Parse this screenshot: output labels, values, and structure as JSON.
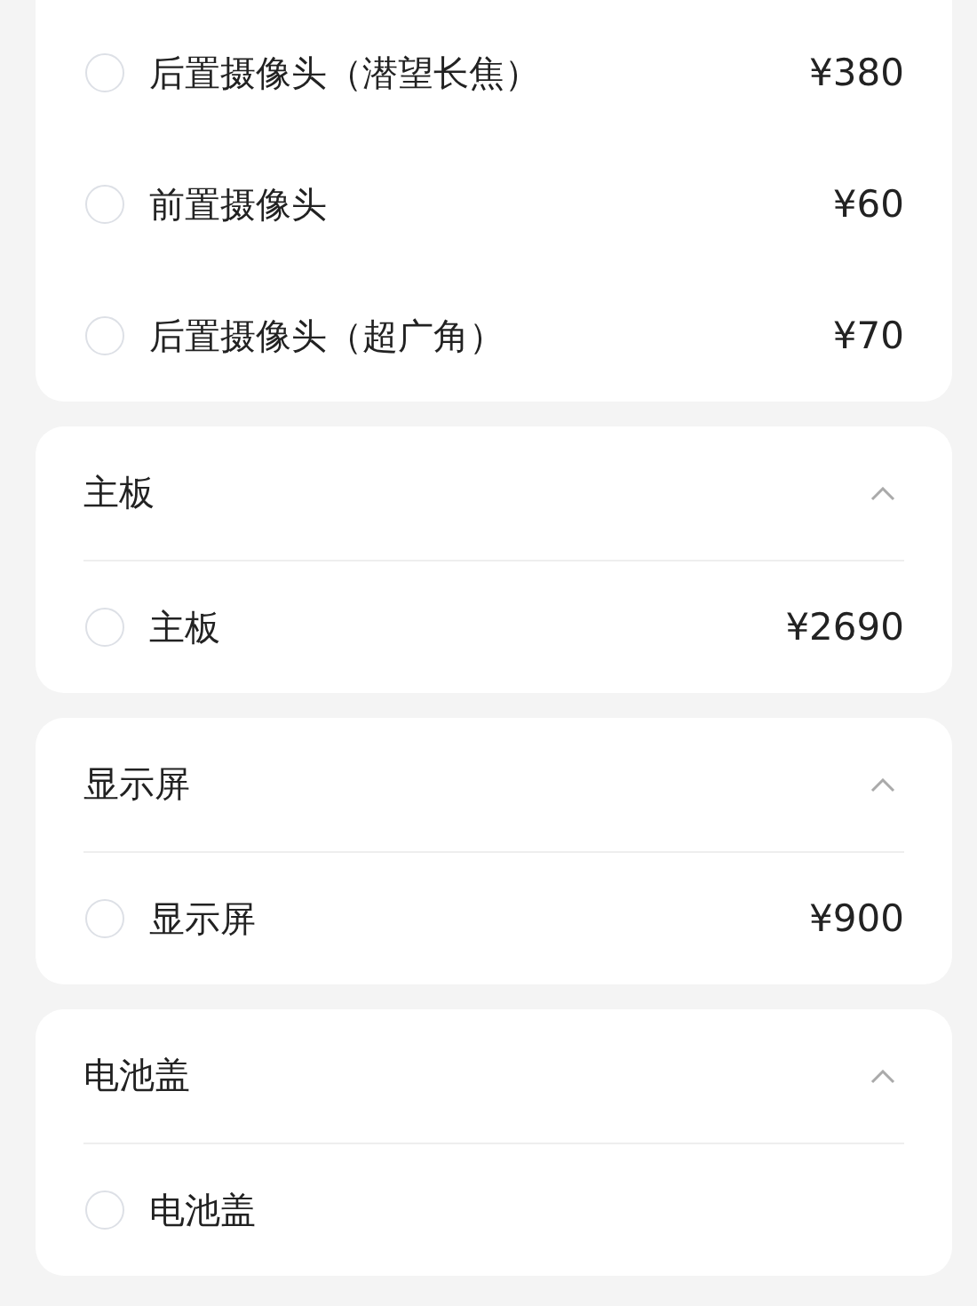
{
  "groups": [
    {
      "items": [
        {
          "name": "后置摄像头（潜望长焦）",
          "price": "¥380",
          "selected": false
        },
        {
          "name": "前置摄像头",
          "price": "¥60",
          "selected": false
        },
        {
          "name": "后置摄像头（超广角）",
          "price": "¥70",
          "selected": false
        }
      ]
    },
    {
      "title": "主板",
      "expanded": true,
      "items": [
        {
          "name": "主板",
          "price": "¥2690",
          "selected": false
        }
      ]
    },
    {
      "title": "显示屏",
      "expanded": true,
      "items": [
        {
          "name": "显示屏",
          "price": "¥900",
          "selected": false
        }
      ]
    },
    {
      "title": "电池盖",
      "expanded": true,
      "items": [
        {
          "name": "电池盖",
          "selected": false
        }
      ]
    }
  ]
}
